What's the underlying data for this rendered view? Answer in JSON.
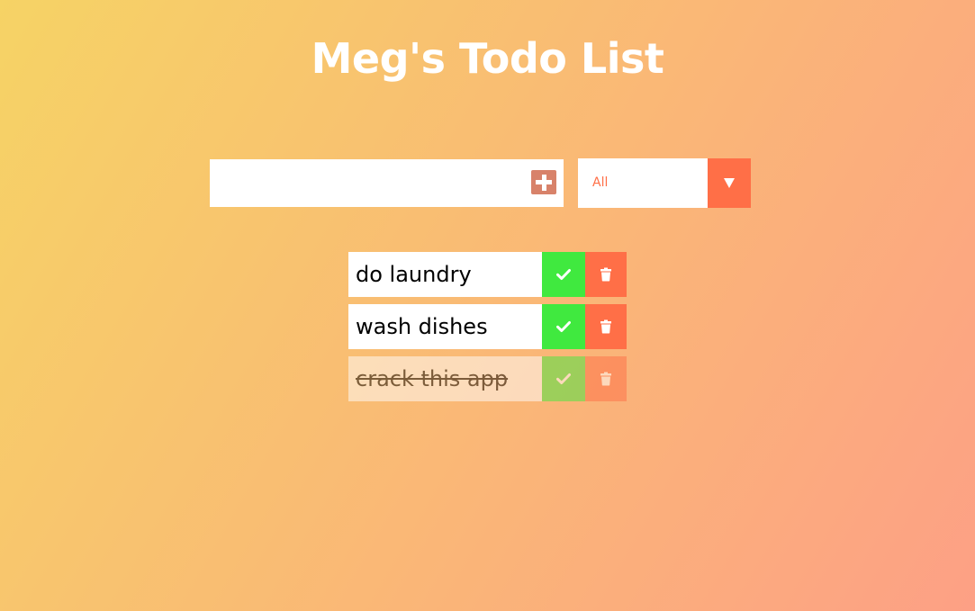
{
  "header": {
    "title": "Meg's Todo List"
  },
  "form": {
    "input_value": "",
    "add_icon": "plus-square-icon",
    "filter": {
      "selected": "All"
    }
  },
  "todos": [
    {
      "text": "do laundry",
      "completed": false
    },
    {
      "text": "wash dishes",
      "completed": false
    },
    {
      "text": "crack this app",
      "completed": true
    }
  ],
  "colors": {
    "gradient_start": "#f6d365",
    "gradient_end": "#fda085",
    "accent": "#ff6f47",
    "complete": "#40e93f",
    "add_button": "#d8826a"
  }
}
